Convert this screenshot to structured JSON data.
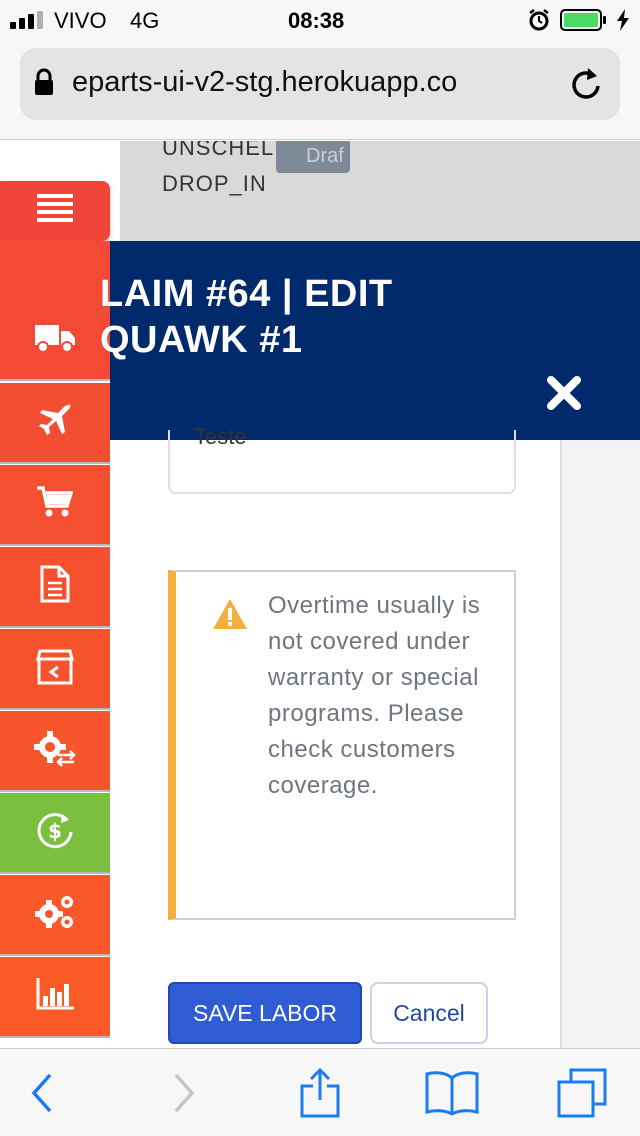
{
  "status_bar": {
    "carrier": "VIVO",
    "network": "4G",
    "time": "08:38"
  },
  "browser": {
    "url": "eparts-ui-v2-stg.herokuapp.co"
  },
  "background_card": {
    "line1": "UNSCHEL",
    "line2": "DROP_IN",
    "badge": "Draf"
  },
  "sidebar": {
    "items": [
      {
        "icon": "hamburger-menu-icon",
        "color": "#f0463a"
      },
      {
        "icon": "truck-icon",
        "color": "#f24a35"
      },
      {
        "icon": "airplane-icon",
        "color": "#f34d32"
      },
      {
        "icon": "cart-icon",
        "color": "#f44f31"
      },
      {
        "icon": "document-icon",
        "color": "#f5512f"
      },
      {
        "icon": "return-box-icon",
        "color": "#f6532d"
      },
      {
        "icon": "gear-exchange-icon",
        "color": "#f7552c"
      },
      {
        "icon": "dollar-refresh-icon",
        "color": "#7abf3e"
      },
      {
        "icon": "gears-icon",
        "color": "#fa5828"
      },
      {
        "icon": "bar-chart-icon",
        "color": "#fb5a26"
      }
    ]
  },
  "modal": {
    "title_line1": "LAIM #64 | EDIT",
    "title_line2": "QUAWK #1",
    "header_color": "#002a6b",
    "note_value": "Teste",
    "warning_text": "Overtime usually is not covered under warranty or special programs. Please check customers coverage.",
    "save_label": "SAVE LABOR",
    "cancel_label": "Cancel"
  },
  "colors": {
    "accent_blue": "#2f5bd3",
    "warning_bar": "#f5ad3b",
    "ios_blue": "#1a7cf5"
  }
}
